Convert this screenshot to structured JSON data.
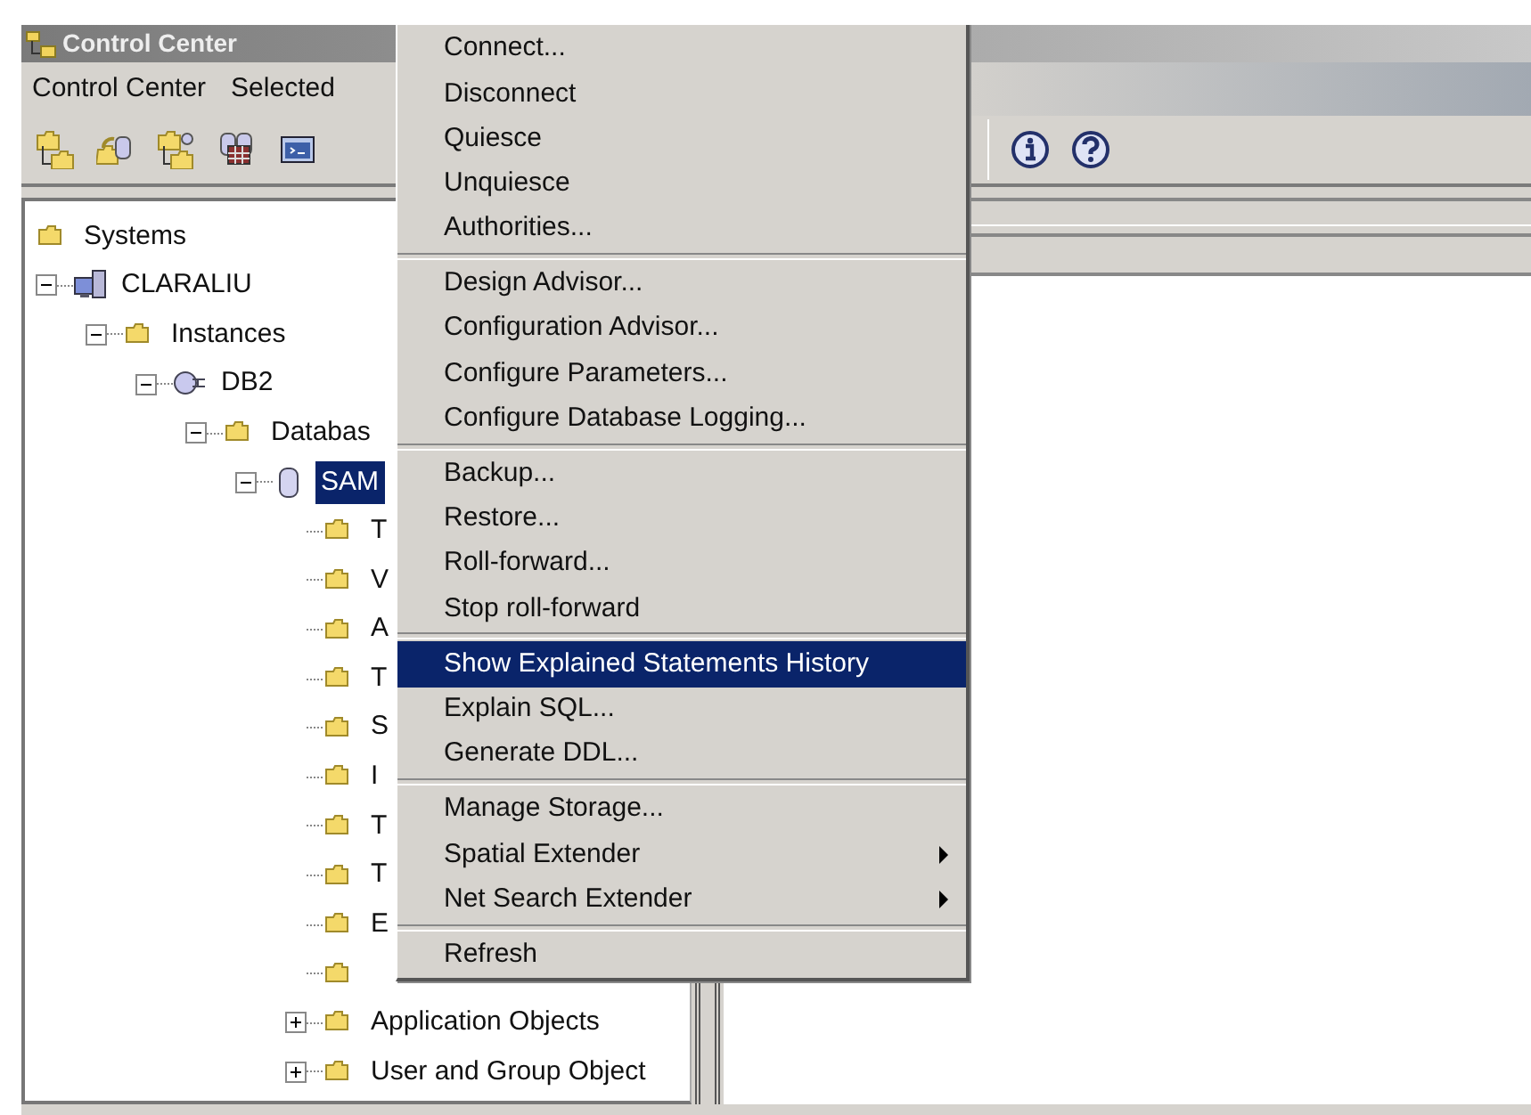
{
  "window": {
    "title": "Control Center"
  },
  "menu_bar": [
    "Control Center",
    "Selected"
  ],
  "tree": [
    {
      "label": "Systems",
      "kind": "folder",
      "selected": false,
      "children": [
        {
          "label": "CLARALIU",
          "kind": "system",
          "selected": false,
          "expanded": true,
          "children": [
            {
              "label": "Instances",
              "kind": "folder",
              "selected": false,
              "expanded": true,
              "children": [
                {
                  "label": "DB2",
                  "kind": "instance",
                  "selected": false,
                  "expanded": true,
                  "children": [
                    {
                      "label": "Databas",
                      "kind": "folder",
                      "selected": false,
                      "expanded": true,
                      "children": [
                        {
                          "label": "SAM",
                          "kind": "database",
                          "selected": true,
                          "expanded": true,
                          "children": [
                            {
                              "label": "T",
                              "kind": "folder"
                            },
                            {
                              "label": "V",
                              "kind": "folder"
                            },
                            {
                              "label": "A",
                              "kind": "folder"
                            },
                            {
                              "label": "T",
                              "kind": "folder"
                            },
                            {
                              "label": "S",
                              "kind": "folder"
                            },
                            {
                              "label": "I",
                              "kind": "folder"
                            },
                            {
                              "label": "T",
                              "kind": "folder"
                            },
                            {
                              "label": "T",
                              "kind": "folder"
                            },
                            {
                              "label": "E",
                              "kind": "folder"
                            },
                            {
                              "kind": "folder"
                            },
                            {
                              "label": "Application Objects",
                              "kind": "folder",
                              "selected": false,
                              "expanded": false
                            },
                            {
                              "label": "User and Group Object",
                              "kind": "folder",
                              "selected": false,
                              "expanded": false
                            }
                          ]
                        }
                      ]
                    }
                  ]
                }
              ]
            }
          ]
        }
      ]
    }
  ],
  "context_menu": {
    "sections": [
      [
        {
          "label": "Connect...",
          "selected": false
        },
        {
          "label": "Disconnect",
          "selected": false
        },
        {
          "label": "Quiesce",
          "selected": false
        },
        {
          "label": "Unquiesce",
          "selected": false
        },
        {
          "label": "Authorities...",
          "selected": false
        }
      ],
      [
        {
          "label": "Design Advisor...",
          "selected": false
        },
        {
          "label": "Configuration Advisor...",
          "selected": false
        },
        {
          "label": "Configure Parameters...",
          "selected": false
        },
        {
          "label": "Configure Database Logging...",
          "selected": false
        }
      ],
      [
        {
          "label": "Backup...",
          "selected": false
        },
        {
          "label": "Restore...",
          "selected": false
        },
        {
          "label": "Roll-forward...",
          "selected": false
        },
        {
          "label": "Stop roll-forward",
          "selected": false
        }
      ],
      [
        {
          "label": "Show Explained Statements History",
          "selected": true
        },
        {
          "label": "Explain SQL...",
          "selected": false
        },
        {
          "label": "Generate DDL...",
          "selected": false
        }
      ],
      [
        {
          "label": "Manage Storage...",
          "selected": false
        },
        {
          "label": "Spatial Extender",
          "selected": false,
          "submenu": true
        },
        {
          "label": "Net Search Extender",
          "selected": false,
          "submenu": true
        }
      ],
      [
        {
          "label": "Refresh",
          "selected": false
        }
      ]
    ]
  }
}
